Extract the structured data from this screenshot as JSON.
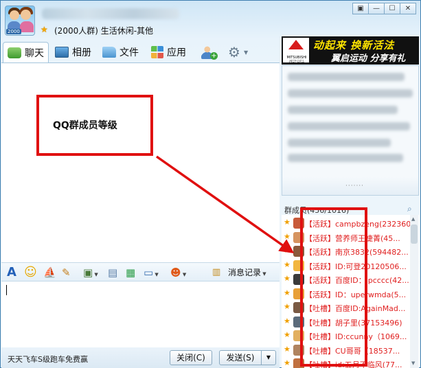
{
  "window": {
    "group_info": "(2000人群) 生活休闲-其他",
    "avatar_tag": "2000",
    "controls": [
      "▣",
      "—",
      "☐",
      "✕"
    ]
  },
  "tabs": [
    {
      "label": "聊天",
      "icon": "chat-icon",
      "active": true
    },
    {
      "label": "相册",
      "icon": "photo-album-icon"
    },
    {
      "label": "文件",
      "icon": "folder-icon"
    },
    {
      "label": "应用",
      "icon": "apps-icon"
    }
  ],
  "ad": {
    "line1": "动起来 换新活法",
    "line2": "翼启运动 分享有礼",
    "brand": "MITSUBISHI MOTORS",
    "drive": "Drive@earth"
  },
  "toolbar": {
    "history_label": "消息记录"
  },
  "bottom": {
    "marquee": "天天飞车S级跑车免费赢",
    "close_label": "关闭(C)",
    "send_label": "发送(S)"
  },
  "members": {
    "header": "群成员(456/1016)",
    "rows": [
      "【活跃】campbzeng(232360)",
      "【活跃】营养师王婕菁(45...",
      "【活跃】南京3832(594482...",
      "【活跃】ID:可登20120506...",
      "【活跃】百度ID：ipcccc(42...",
      "【活跃】ID：uperwmda(5...",
      "【吐槽】百度ID:AgainMad...",
      "【吐槽】胡子里(37153496)",
      "【吐槽】ID:ccunny（1069...",
      "【吐槽】CU哥哥（18537...",
      "【吐槽】id:五月不临风(77..."
    ],
    "row_avatar_colors": [
      "#c85a3a",
      "#d69460",
      "#8a5a3c",
      "#f2b640",
      "#3a3a3a",
      "#e8a038",
      "#7a5a44",
      "#5b6b7b",
      "#e2b060",
      "#b08460",
      "#c07040"
    ]
  },
  "annotation": {
    "label": "QQ群成员等级",
    "color": "#e01010"
  }
}
